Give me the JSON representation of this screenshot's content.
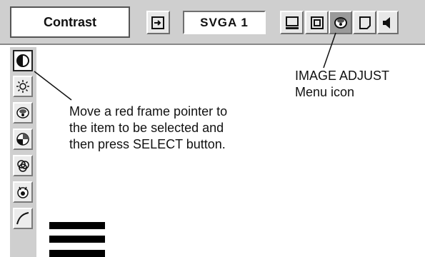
{
  "menu": {
    "title": "Contrast",
    "source": "SVGA 1",
    "icons": [
      "input-select-icon",
      "pc-adjust-icon",
      "screen-icon",
      "image-adjust-icon",
      "image-select-icon",
      "sound-icon"
    ],
    "active_icon": "image-adjust-icon"
  },
  "side_menu": {
    "items": [
      {
        "icon": "contrast-icon",
        "selected": true
      },
      {
        "icon": "brightness-icon",
        "selected": false
      },
      {
        "icon": "color-icon",
        "selected": false
      },
      {
        "icon": "tint-icon",
        "selected": false
      },
      {
        "icon": "color-balance-icon",
        "selected": false
      },
      {
        "icon": "white-balance-icon",
        "selected": false
      },
      {
        "icon": "gamma-icon",
        "selected": false
      }
    ]
  },
  "callouts": {
    "menu_icon_line1": "IMAGE ADJUST",
    "menu_icon_line2": "Menu icon",
    "pointer_line1": "Move a red frame pointer to",
    "pointer_line2": "the item to be selected and",
    "pointer_line3": "then press SELECT button."
  }
}
